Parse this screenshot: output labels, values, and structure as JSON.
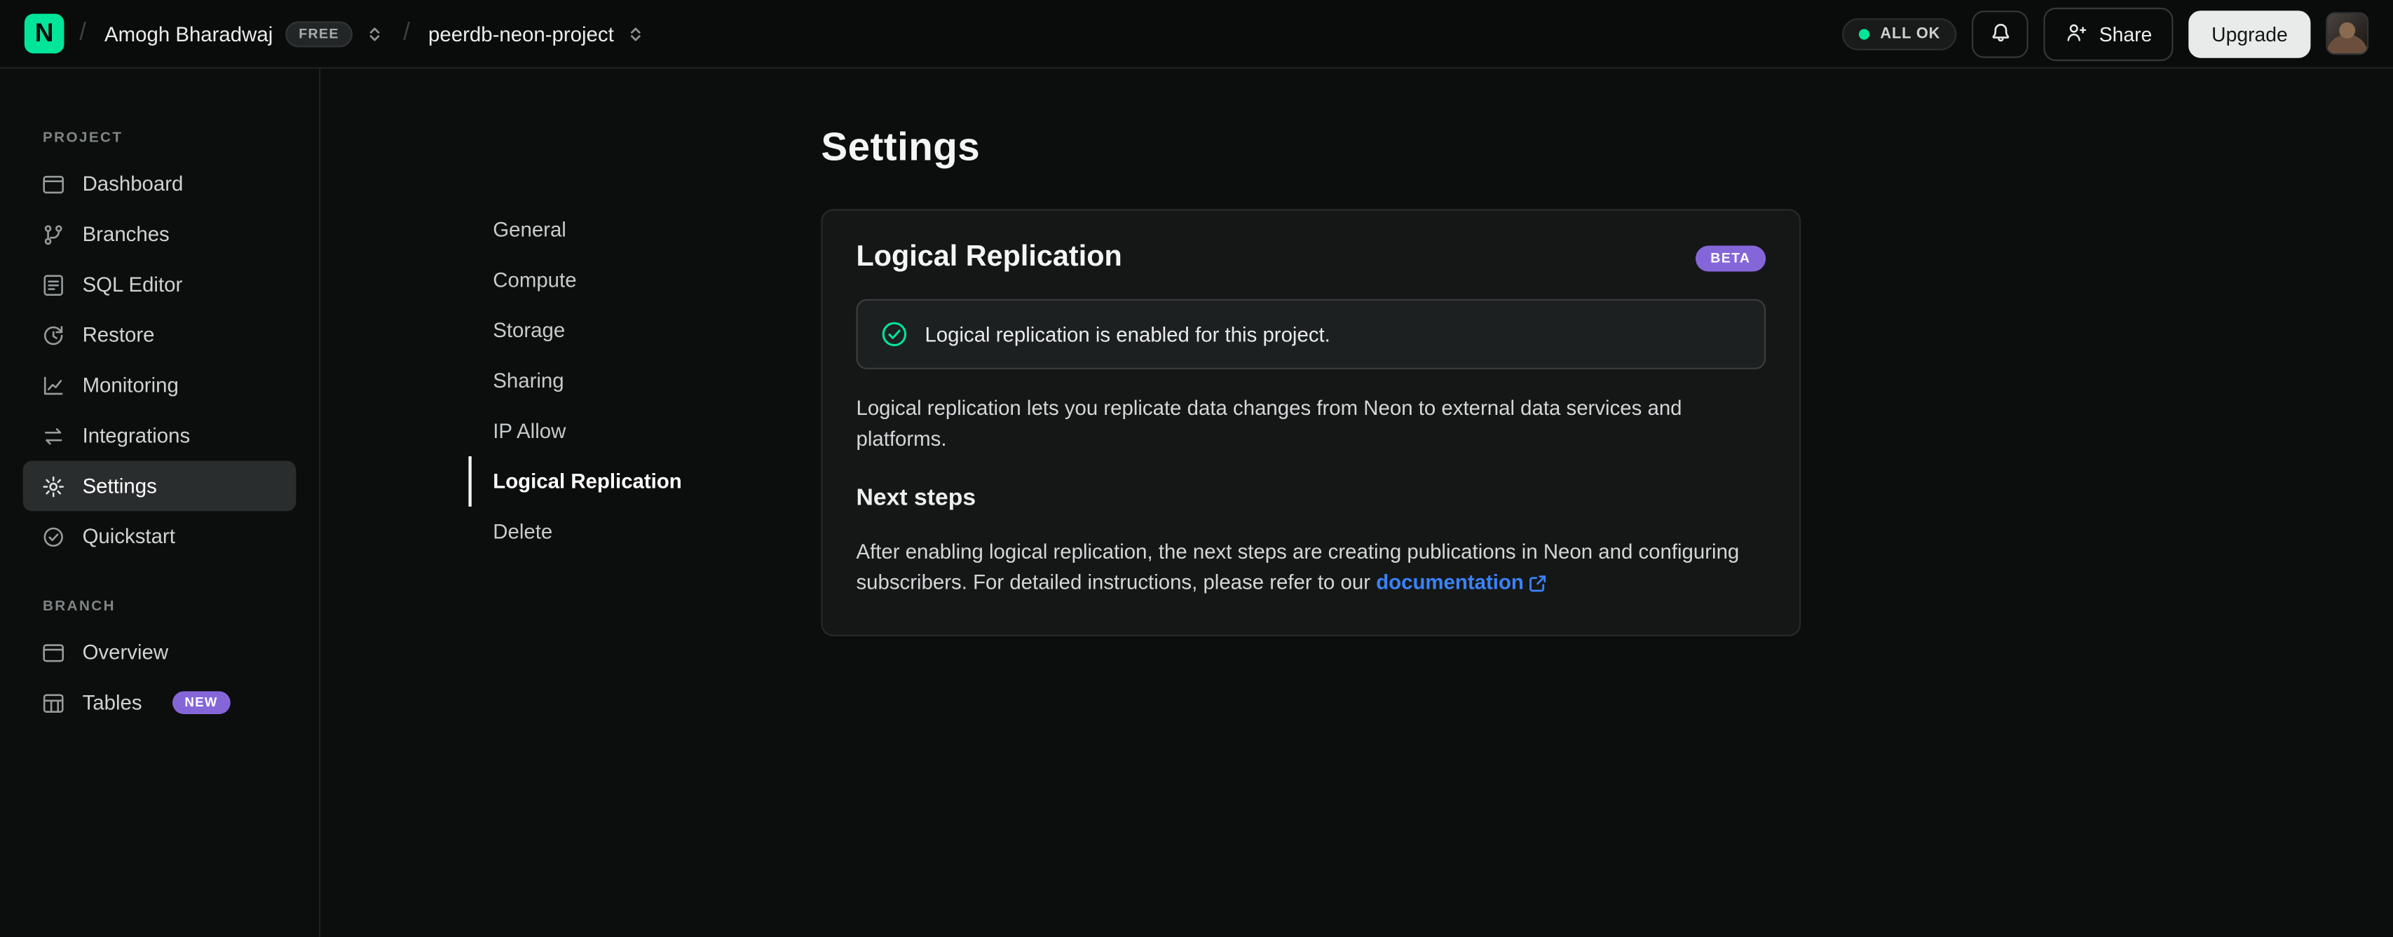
{
  "topbar": {
    "org": {
      "name": "Amogh Bharadwaj",
      "plan_badge": "FREE"
    },
    "project": {
      "name": "peerdb-neon-project"
    },
    "status_label": "ALL OK",
    "share_label": "Share",
    "upgrade_label": "Upgrade"
  },
  "sidebar": {
    "project_section": {
      "title": "PROJECT",
      "items": [
        {
          "label": "Dashboard",
          "icon": "dashboard-icon"
        },
        {
          "label": "Branches",
          "icon": "git-branch-icon"
        },
        {
          "label": "SQL Editor",
          "icon": "sql-editor-icon"
        },
        {
          "label": "Restore",
          "icon": "restore-icon"
        },
        {
          "label": "Monitoring",
          "icon": "monitoring-icon"
        },
        {
          "label": "Integrations",
          "icon": "integrations-icon"
        },
        {
          "label": "Settings",
          "icon": "gear-icon",
          "active": true
        },
        {
          "label": "Quickstart",
          "icon": "check-circle-icon"
        }
      ]
    },
    "branch_section": {
      "title": "BRANCH",
      "items": [
        {
          "label": "Overview",
          "icon": "overview-icon"
        },
        {
          "label": "Tables",
          "icon": "tables-icon",
          "badge": "NEW"
        }
      ]
    }
  },
  "settings": {
    "page_title": "Settings",
    "nav": [
      "General",
      "Compute",
      "Storage",
      "Sharing",
      "IP Allow",
      "Logical Replication",
      "Delete"
    ],
    "active_nav": "Logical Replication",
    "card": {
      "title": "Logical Replication",
      "beta_badge": "BETA",
      "status_message": "Logical replication is enabled for this project.",
      "description": "Logical replication lets you replicate data changes from Neon to external data services and platforms.",
      "next_steps_title": "Next steps",
      "next_steps_text": "After enabling logical replication, the next steps are creating publications in Neon and configuring subscribers. For detailed instructions, please refer to our ",
      "link_label": "documentation"
    }
  },
  "colors": {
    "accent_green": "#00e599",
    "badge_purple": "#8566d9",
    "link_blue": "#3b82f6",
    "status_dot_green": "#00e599"
  }
}
